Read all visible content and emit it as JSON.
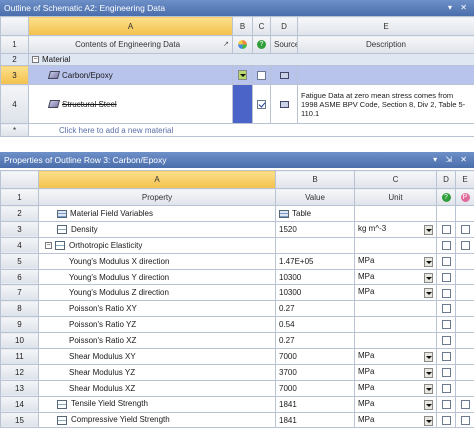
{
  "outline": {
    "title": "Outline of Schematic A2: Engineering Data",
    "window_controls": "▾ ✕",
    "columns": [
      "A",
      "B",
      "C",
      "D",
      "E"
    ],
    "row_headers": [
      "1",
      "2",
      "3",
      "4",
      "*"
    ],
    "header_row": {
      "contents": "Contents of Engineering Data",
      "source": "Source",
      "description": "Description"
    },
    "section_label": "Material",
    "materials": [
      {
        "name": "Carbon/Epoxy",
        "checked": false,
        "description": ""
      },
      {
        "name": "Structural Steel",
        "checked": true,
        "description": "Fatigue Data at zero mean stress comes from 1998 ASME BPV Code, Section 8, Div 2, Table 5-110.1"
      }
    ],
    "add_new": "Click here to add a new material"
  },
  "properties": {
    "title": "Properties of Outline Row 3: Carbon/Epoxy",
    "window_controls": "▾ ⇲ ✕",
    "columns": [
      "A",
      "B",
      "C",
      "D",
      "E"
    ],
    "header_row": {
      "property": "Property",
      "value": "Value",
      "unit": "Unit"
    },
    "rows": [
      {
        "n": "2",
        "name": "Material Field Variables",
        "icon": "table",
        "value": "Table",
        "unit": "",
        "unit_dd": false,
        "checks": 0,
        "indent": 1
      },
      {
        "n": "3",
        "name": "Density",
        "icon": "prop",
        "value": "1520",
        "unit": "kg m^-3",
        "unit_dd": true,
        "checks": 2,
        "indent": 1
      },
      {
        "n": "4",
        "name": "Orthotropic Elasticity",
        "icon": "prop",
        "value": "",
        "unit": "",
        "unit_dd": false,
        "checks": 2,
        "indent": 0,
        "expander": "−"
      },
      {
        "n": "5",
        "name": "Young's Modulus X direction",
        "icon": "",
        "value": "1.47E+05",
        "unit": "MPa",
        "unit_dd": true,
        "checks": 1,
        "indent": 2
      },
      {
        "n": "6",
        "name": "Young's Modulus Y direction",
        "icon": "",
        "value": "10300",
        "unit": "MPa",
        "unit_dd": true,
        "checks": 1,
        "indent": 2
      },
      {
        "n": "7",
        "name": "Young's Modulus Z direction",
        "icon": "",
        "value": "10300",
        "unit": "MPa",
        "unit_dd": true,
        "checks": 1,
        "indent": 2
      },
      {
        "n": "8",
        "name": "Poisson's Ratio XY",
        "icon": "",
        "value": "0.27",
        "unit": "",
        "unit_dd": false,
        "checks": 1,
        "indent": 2
      },
      {
        "n": "9",
        "name": "Poisson's Ratio YZ",
        "icon": "",
        "value": "0.54",
        "unit": "",
        "unit_dd": false,
        "checks": 1,
        "indent": 2
      },
      {
        "n": "10",
        "name": "Poisson's Ratio XZ",
        "icon": "",
        "value": "0.27",
        "unit": "",
        "unit_dd": false,
        "checks": 1,
        "indent": 2
      },
      {
        "n": "11",
        "name": "Shear Modulus XY",
        "icon": "",
        "value": "7000",
        "unit": "MPa",
        "unit_dd": true,
        "checks": 1,
        "indent": 2
      },
      {
        "n": "12",
        "name": "Shear Modulus YZ",
        "icon": "",
        "value": "3700",
        "unit": "MPa",
        "unit_dd": true,
        "checks": 1,
        "indent": 2
      },
      {
        "n": "13",
        "name": "Shear Modulus XZ",
        "icon": "",
        "value": "7000",
        "unit": "MPa",
        "unit_dd": true,
        "checks": 1,
        "indent": 2
      },
      {
        "n": "14",
        "name": "Tensile Yield Strength",
        "icon": "prop",
        "value": "1841",
        "unit": "MPa",
        "unit_dd": true,
        "checks": 2,
        "indent": 1
      },
      {
        "n": "15",
        "name": "Compressive Yield Strength",
        "icon": "prop",
        "value": "1841",
        "unit": "MPa",
        "unit_dd": true,
        "checks": 2,
        "indent": 1
      }
    ]
  }
}
